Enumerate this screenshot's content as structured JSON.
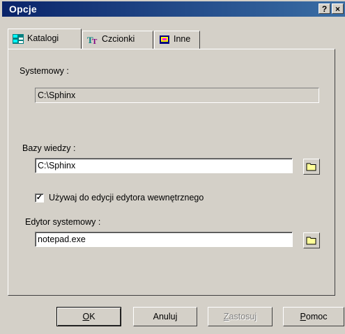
{
  "window": {
    "title": "Opcje",
    "help_label": "?",
    "close_label": "×"
  },
  "tabs": [
    {
      "label": "Katalogi",
      "icon": "folders-icon",
      "active": true
    },
    {
      "label": "Czcionki",
      "icon": "font-icon",
      "active": false
    },
    {
      "label": "Inne",
      "icon": "other-icon",
      "active": false
    }
  ],
  "katalogi": {
    "systemowy": {
      "label": "Systemowy :",
      "value": "C:\\Sphinx"
    },
    "bazy_wiedzy": {
      "label": "Bazy wiedzy :",
      "value": "C:\\Sphinx"
    },
    "checkbox": {
      "label": "Używaj do edycji edytora wewnętrznego",
      "checked": true
    },
    "edytor": {
      "label": "Edytor systemowy :",
      "value": "notepad.exe"
    }
  },
  "buttons": {
    "ok": {
      "hotkey": "O",
      "rest": "K"
    },
    "anuluj": {
      "label": "Anuluj"
    },
    "zastosuj": {
      "hotkey": "Z",
      "rest": "astosuj"
    },
    "pomoc": {
      "hotkey": "P",
      "rest": "omoc"
    }
  }
}
